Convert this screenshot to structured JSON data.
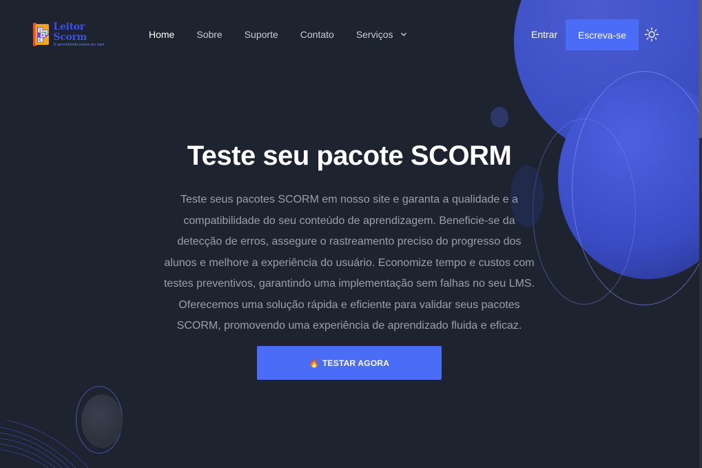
{
  "brand": {
    "name": "Leitor Scorm",
    "tagline": "O aprendizado passa por aqui",
    "mark_letters": [
      "S",
      "O",
      "R",
      "C"
    ],
    "primary_color": "#4a6cf7"
  },
  "nav": {
    "items": [
      {
        "label": "Home",
        "active": true
      },
      {
        "label": "Sobre",
        "active": false
      },
      {
        "label": "Suporte",
        "active": false
      },
      {
        "label": "Contato",
        "active": false
      }
    ],
    "dropdown": {
      "label": "Serviços",
      "icon": "chevron-down-icon"
    }
  },
  "header_actions": {
    "login_label": "Entrar",
    "signup_label": "Escreva-se",
    "theme_icon": "sun-icon"
  },
  "hero": {
    "title": "Teste seu pacote SCORM",
    "description": "Teste seus pacotes SCORM em nosso site e garanta a qualidade e a compatibilidade do seu conteúdo de aprendizagem. Beneficie-se da detecção de erros, assegure o rastreamento preciso do progresso dos alunos e melhore a experiência do usuário. Economize tempo e custos com testes preventivos, garantindo uma implementação sem falhas no seu LMS. Oferecemos uma solução rápida e eficiente para validar seus pacotes SCORM, promovendo uma experiência de aprendizado fluida e eficaz.",
    "cta_label": "TESTAR AGORA",
    "cta_icon": "🔥"
  },
  "theme": {
    "background": "#1e2330",
    "accent": "#4a6cf7"
  }
}
